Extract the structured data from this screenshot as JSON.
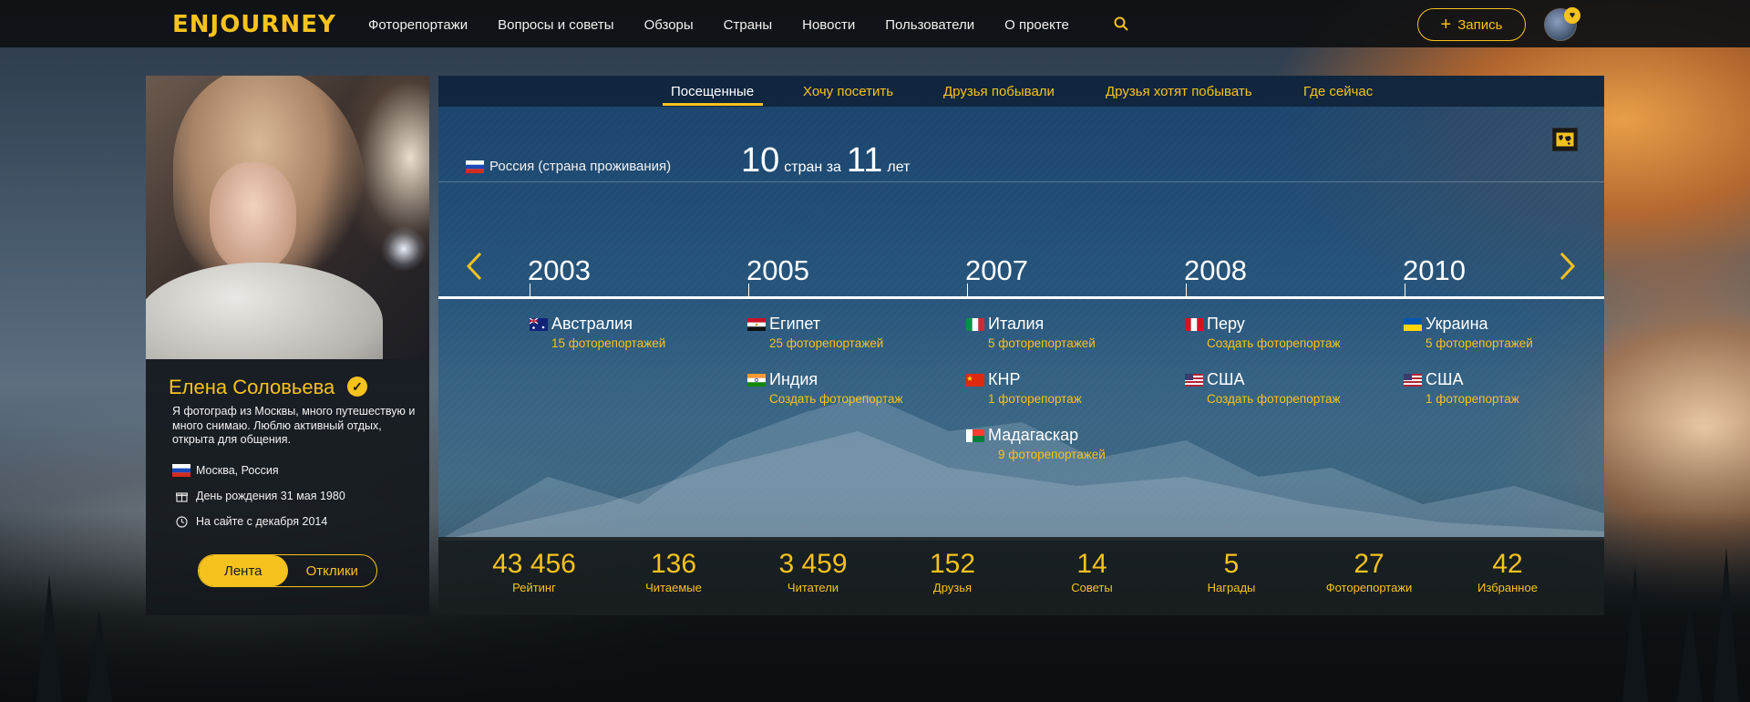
{
  "header": {
    "logo_text": "ENJOURNEY",
    "nav": [
      "Фоторепортажи",
      "Вопросы и советы",
      "Обзоры",
      "Страны",
      "Новости",
      "Пользователи",
      "О проекте"
    ],
    "write_label": "Запись",
    "accent_color": "#f6c21e"
  },
  "profile": {
    "name": "Елена Соловьева",
    "bio": "Я фотограф из Москвы, много путешествую и много снимаю. Люблю активный отдых, открыта для общения.",
    "location": "Москва, Россия",
    "birthday": "День рождения 31 мая 1980",
    "member_since": "На сайте с декабря 2014",
    "toggle": {
      "active": "Лента",
      "inactive": "Отклики"
    }
  },
  "tabs": [
    "Посещенные",
    "Хочу посетить",
    "Друзья побывали",
    "Друзья хотят побывать",
    "Где сейчас"
  ],
  "summary": {
    "residence": "Россия (страна проживания)",
    "countries_count": "10",
    "countries_word": "стран за",
    "years_count": "11",
    "years_word": "лет"
  },
  "timeline": [
    {
      "year": "2003",
      "entries": [
        {
          "flag": "au",
          "country": "Австралия",
          "sub": "15 фоторепортажей"
        }
      ]
    },
    {
      "year": "2005",
      "entries": [
        {
          "flag": "eg",
          "country": "Египет",
          "sub": "25 фоторепортажей"
        },
        {
          "flag": "in",
          "country": "Индия",
          "sub": "Создать фоторепортаж"
        }
      ]
    },
    {
      "year": "2007",
      "entries": [
        {
          "flag": "it",
          "country": "Италия",
          "sub": "5 фоторепортажей"
        },
        {
          "flag": "cn",
          "country": "КНР",
          "sub": "1 фоторепортаж"
        },
        {
          "flag": "mg",
          "country": "Мадагаскар",
          "sub": "9 фоторепортажей"
        }
      ]
    },
    {
      "year": "2008",
      "entries": [
        {
          "flag": "pe",
          "country": "Перу",
          "sub": "Создать фоторепортаж"
        },
        {
          "flag": "us",
          "country": "США",
          "sub": "Создать фоторепортаж"
        }
      ]
    },
    {
      "year": "2010",
      "entries": [
        {
          "flag": "ua",
          "country": "Украина",
          "sub": "5 фоторепортажей"
        },
        {
          "flag": "us",
          "country": "США",
          "sub": "1 фоторепортаж"
        }
      ]
    }
  ],
  "stats": [
    {
      "num": "43 456",
      "label": "Рейтинг"
    },
    {
      "num": "136",
      "label": "Читаемые"
    },
    {
      "num": "3 459",
      "label": "Читатели"
    },
    {
      "num": "152",
      "label": "Друзья"
    },
    {
      "num": "14",
      "label": "Советы"
    },
    {
      "num": "5",
      "label": "Награды"
    },
    {
      "num": "27",
      "label": "Фоторепортажи"
    },
    {
      "num": "42",
      "label": "Избранное"
    }
  ]
}
